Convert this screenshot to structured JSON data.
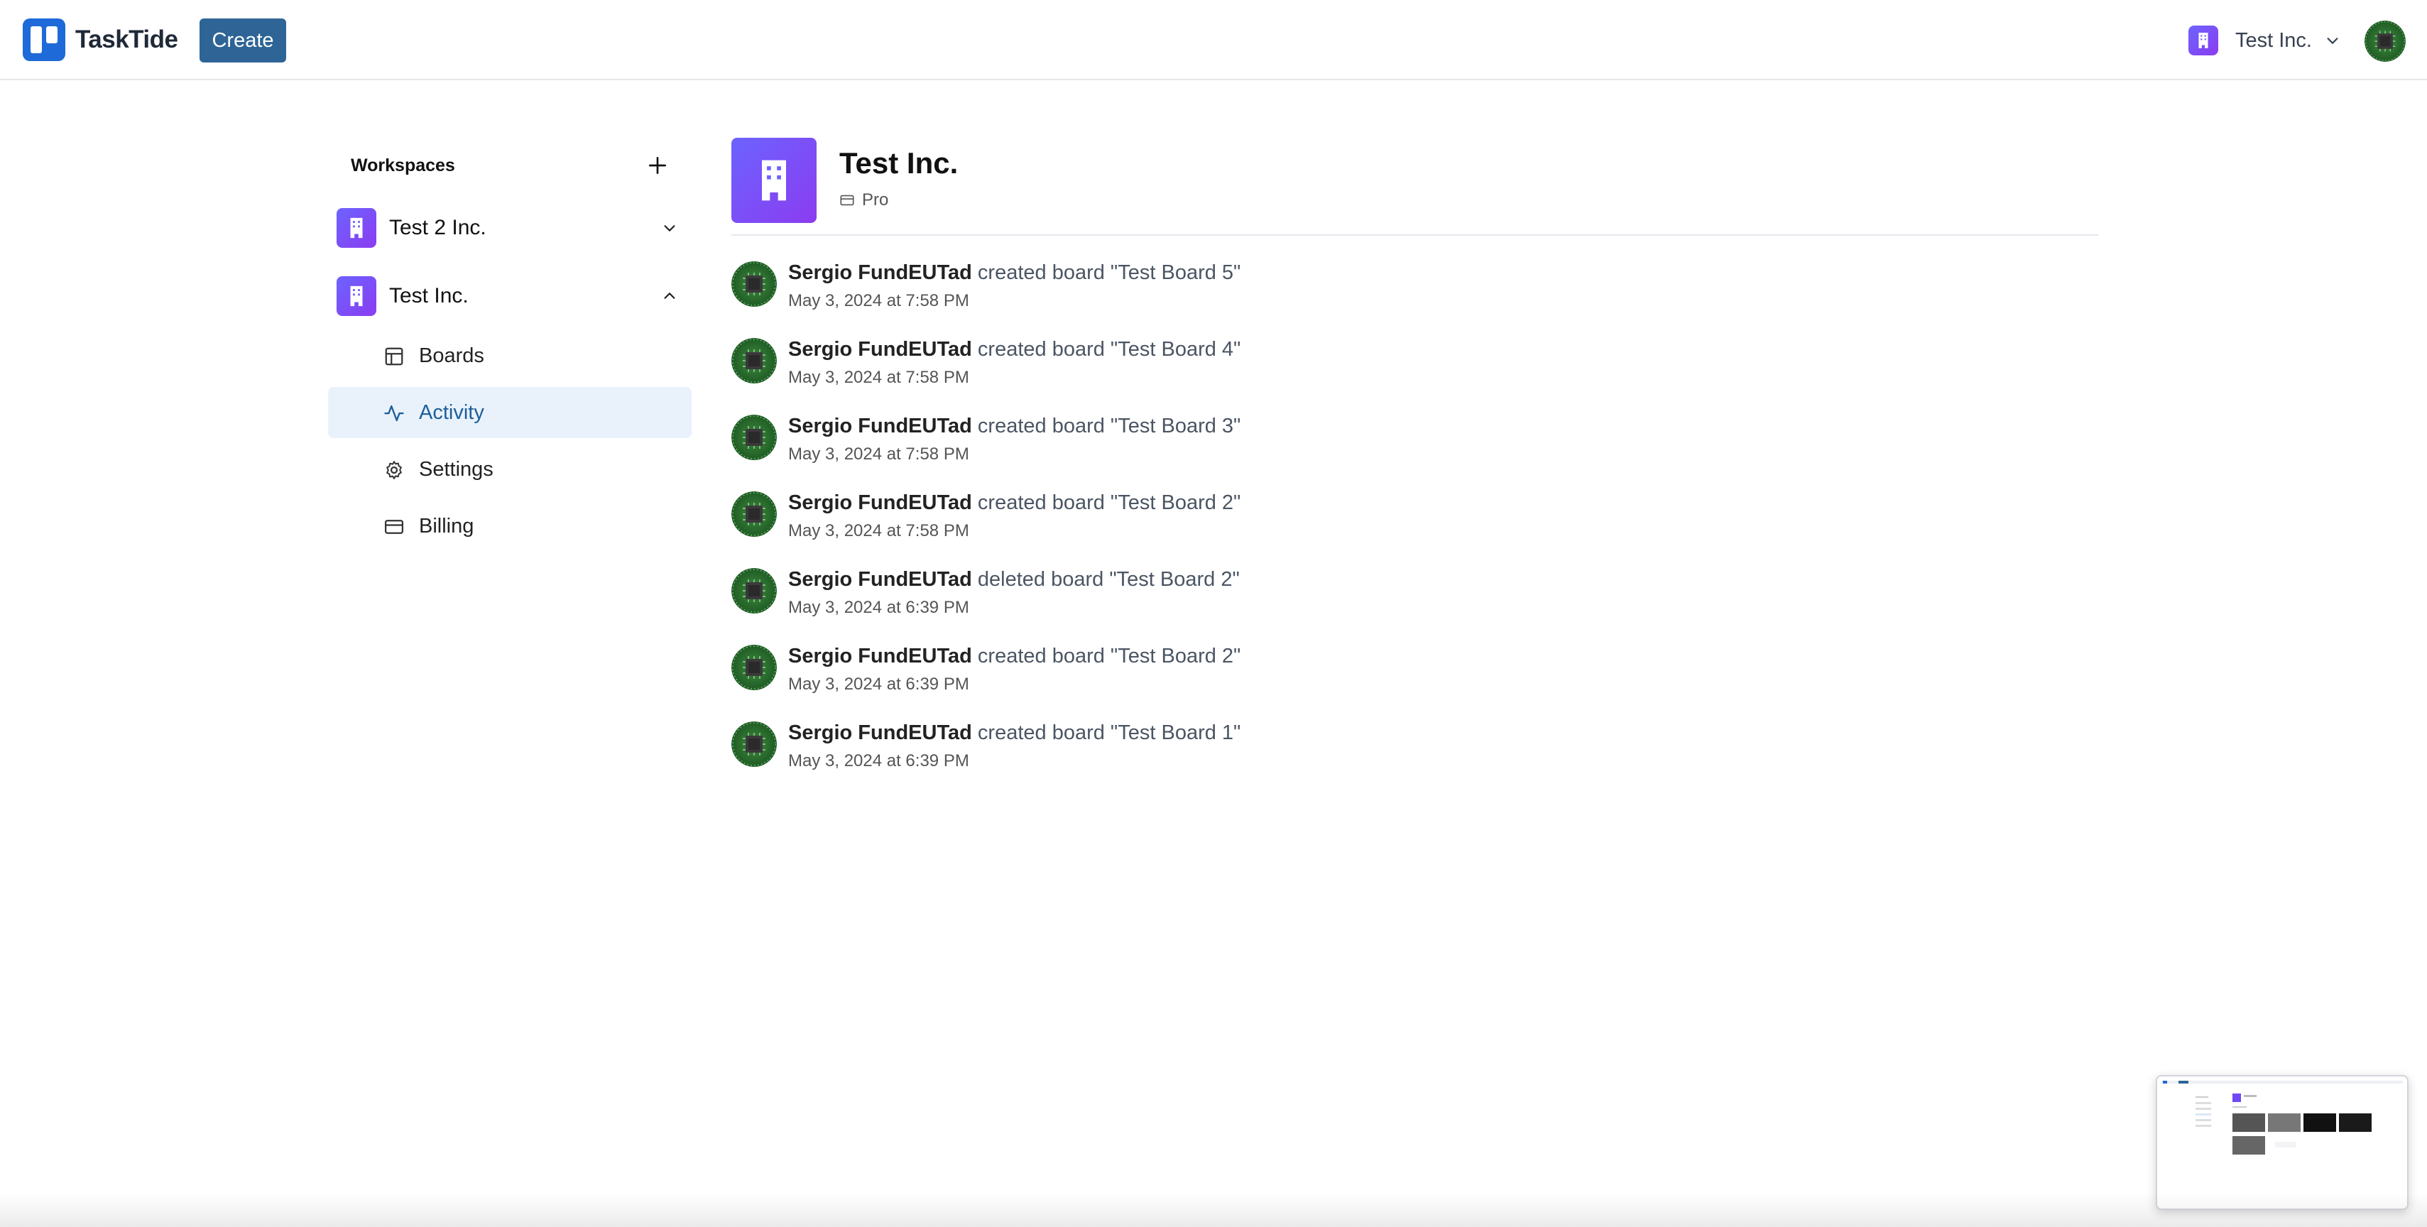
{
  "navbar": {
    "brand": "TaskTide",
    "create_label": "Create",
    "org_name": "Test Inc.",
    "icons": {
      "logo": "tasktide-logo-icon",
      "org": "building-icon",
      "chevron": "chevron-down-icon",
      "avatar": "user-avatar"
    }
  },
  "sidebar": {
    "title": "Workspaces",
    "workspaces": [
      {
        "name": "Test 2 Inc.",
        "expanded": false
      },
      {
        "name": "Test Inc.",
        "expanded": true
      }
    ],
    "items": [
      {
        "label": "Boards",
        "icon": "layout-icon",
        "active": false
      },
      {
        "label": "Activity",
        "icon": "activity-icon",
        "active": true
      },
      {
        "label": "Settings",
        "icon": "gear-icon",
        "active": false
      },
      {
        "label": "Billing",
        "icon": "credit-card-icon",
        "active": false
      }
    ]
  },
  "main": {
    "org_name": "Test Inc.",
    "plan": "Pro",
    "activities": [
      {
        "user": "Sergio FundEUTad",
        "action": "created board \"Test Board 5\"",
        "time": "May 3, 2024 at 7:58 PM"
      },
      {
        "user": "Sergio FundEUTad",
        "action": "created board \"Test Board 4\"",
        "time": "May 3, 2024 at 7:58 PM"
      },
      {
        "user": "Sergio FundEUTad",
        "action": "created board \"Test Board 3\"",
        "time": "May 3, 2024 at 7:58 PM"
      },
      {
        "user": "Sergio FundEUTad",
        "action": "created board \"Test Board 2\"",
        "time": "May 3, 2024 at 7:58 PM"
      },
      {
        "user": "Sergio FundEUTad",
        "action": "deleted board \"Test Board 2\"",
        "time": "May 3, 2024 at 6:39 PM"
      },
      {
        "user": "Sergio FundEUTad",
        "action": "created board \"Test Board 2\"",
        "time": "May 3, 2024 at 6:39 PM"
      },
      {
        "user": "Sergio FundEUTad",
        "action": "created board \"Test Board 1\"",
        "time": "May 3, 2024 at 6:39 PM"
      }
    ]
  },
  "colors": {
    "brand": "#1d6ad8",
    "create_button": "#2e6596",
    "org_badge": "#7048f5",
    "active_item_bg": "#e9f2fb",
    "active_item_text": "#1e5f9a"
  }
}
